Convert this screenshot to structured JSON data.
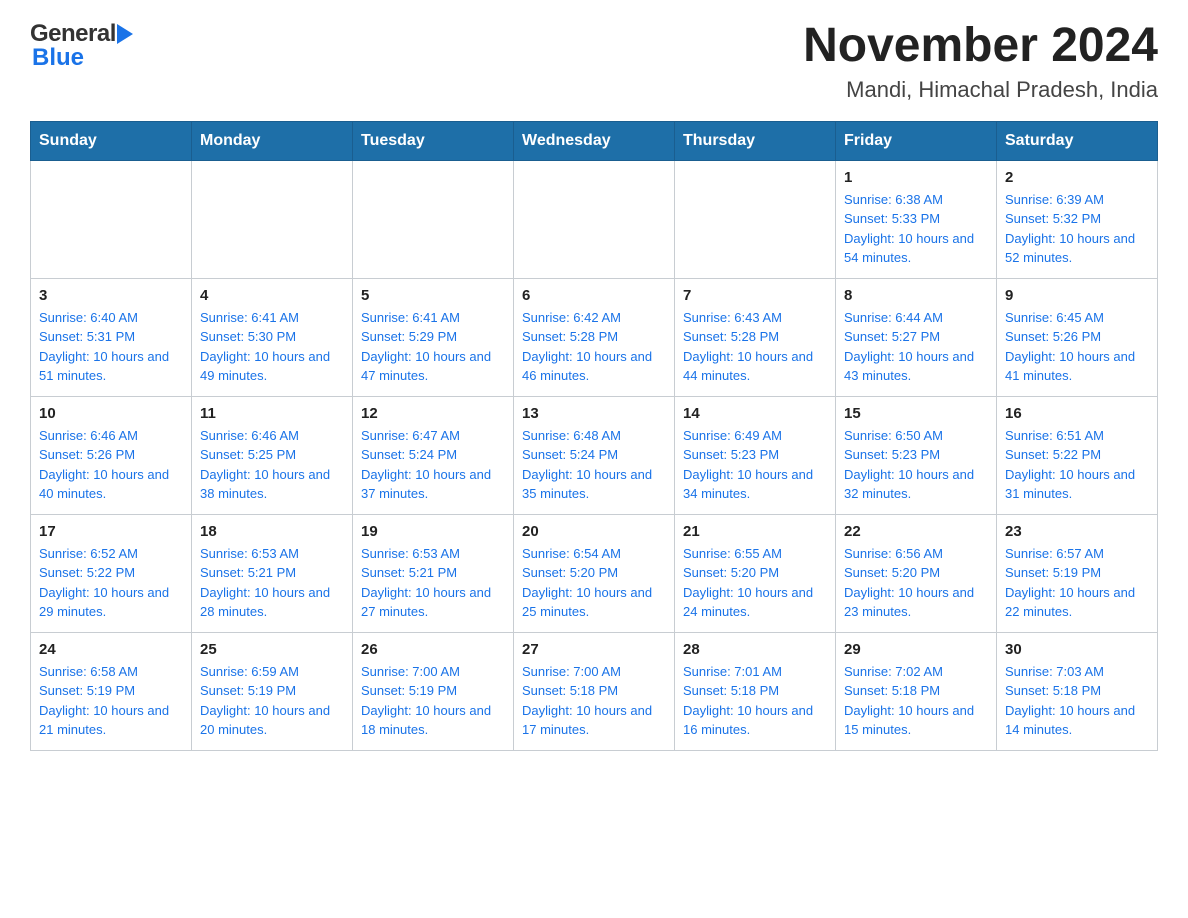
{
  "header": {
    "title": "November 2024",
    "subtitle": "Mandi, Himachal Pradesh, India",
    "logo_general": "General",
    "logo_blue": "Blue"
  },
  "days_of_week": [
    "Sunday",
    "Monday",
    "Tuesday",
    "Wednesday",
    "Thursday",
    "Friday",
    "Saturday"
  ],
  "weeks": [
    [
      {
        "day": "",
        "sunrise": "",
        "sunset": "",
        "daylight": ""
      },
      {
        "day": "",
        "sunrise": "",
        "sunset": "",
        "daylight": ""
      },
      {
        "day": "",
        "sunrise": "",
        "sunset": "",
        "daylight": ""
      },
      {
        "day": "",
        "sunrise": "",
        "sunset": "",
        "daylight": ""
      },
      {
        "day": "",
        "sunrise": "",
        "sunset": "",
        "daylight": ""
      },
      {
        "day": "1",
        "sunrise": "Sunrise: 6:38 AM",
        "sunset": "Sunset: 5:33 PM",
        "daylight": "Daylight: 10 hours and 54 minutes."
      },
      {
        "day": "2",
        "sunrise": "Sunrise: 6:39 AM",
        "sunset": "Sunset: 5:32 PM",
        "daylight": "Daylight: 10 hours and 52 minutes."
      }
    ],
    [
      {
        "day": "3",
        "sunrise": "Sunrise: 6:40 AM",
        "sunset": "Sunset: 5:31 PM",
        "daylight": "Daylight: 10 hours and 51 minutes."
      },
      {
        "day": "4",
        "sunrise": "Sunrise: 6:41 AM",
        "sunset": "Sunset: 5:30 PM",
        "daylight": "Daylight: 10 hours and 49 minutes."
      },
      {
        "day": "5",
        "sunrise": "Sunrise: 6:41 AM",
        "sunset": "Sunset: 5:29 PM",
        "daylight": "Daylight: 10 hours and 47 minutes."
      },
      {
        "day": "6",
        "sunrise": "Sunrise: 6:42 AM",
        "sunset": "Sunset: 5:28 PM",
        "daylight": "Daylight: 10 hours and 46 minutes."
      },
      {
        "day": "7",
        "sunrise": "Sunrise: 6:43 AM",
        "sunset": "Sunset: 5:28 PM",
        "daylight": "Daylight: 10 hours and 44 minutes."
      },
      {
        "day": "8",
        "sunrise": "Sunrise: 6:44 AM",
        "sunset": "Sunset: 5:27 PM",
        "daylight": "Daylight: 10 hours and 43 minutes."
      },
      {
        "day": "9",
        "sunrise": "Sunrise: 6:45 AM",
        "sunset": "Sunset: 5:26 PM",
        "daylight": "Daylight: 10 hours and 41 minutes."
      }
    ],
    [
      {
        "day": "10",
        "sunrise": "Sunrise: 6:46 AM",
        "sunset": "Sunset: 5:26 PM",
        "daylight": "Daylight: 10 hours and 40 minutes."
      },
      {
        "day": "11",
        "sunrise": "Sunrise: 6:46 AM",
        "sunset": "Sunset: 5:25 PM",
        "daylight": "Daylight: 10 hours and 38 minutes."
      },
      {
        "day": "12",
        "sunrise": "Sunrise: 6:47 AM",
        "sunset": "Sunset: 5:24 PM",
        "daylight": "Daylight: 10 hours and 37 minutes."
      },
      {
        "day": "13",
        "sunrise": "Sunrise: 6:48 AM",
        "sunset": "Sunset: 5:24 PM",
        "daylight": "Daylight: 10 hours and 35 minutes."
      },
      {
        "day": "14",
        "sunrise": "Sunrise: 6:49 AM",
        "sunset": "Sunset: 5:23 PM",
        "daylight": "Daylight: 10 hours and 34 minutes."
      },
      {
        "day": "15",
        "sunrise": "Sunrise: 6:50 AM",
        "sunset": "Sunset: 5:23 PM",
        "daylight": "Daylight: 10 hours and 32 minutes."
      },
      {
        "day": "16",
        "sunrise": "Sunrise: 6:51 AM",
        "sunset": "Sunset: 5:22 PM",
        "daylight": "Daylight: 10 hours and 31 minutes."
      }
    ],
    [
      {
        "day": "17",
        "sunrise": "Sunrise: 6:52 AM",
        "sunset": "Sunset: 5:22 PM",
        "daylight": "Daylight: 10 hours and 29 minutes."
      },
      {
        "day": "18",
        "sunrise": "Sunrise: 6:53 AM",
        "sunset": "Sunset: 5:21 PM",
        "daylight": "Daylight: 10 hours and 28 minutes."
      },
      {
        "day": "19",
        "sunrise": "Sunrise: 6:53 AM",
        "sunset": "Sunset: 5:21 PM",
        "daylight": "Daylight: 10 hours and 27 minutes."
      },
      {
        "day": "20",
        "sunrise": "Sunrise: 6:54 AM",
        "sunset": "Sunset: 5:20 PM",
        "daylight": "Daylight: 10 hours and 25 minutes."
      },
      {
        "day": "21",
        "sunrise": "Sunrise: 6:55 AM",
        "sunset": "Sunset: 5:20 PM",
        "daylight": "Daylight: 10 hours and 24 minutes."
      },
      {
        "day": "22",
        "sunrise": "Sunrise: 6:56 AM",
        "sunset": "Sunset: 5:20 PM",
        "daylight": "Daylight: 10 hours and 23 minutes."
      },
      {
        "day": "23",
        "sunrise": "Sunrise: 6:57 AM",
        "sunset": "Sunset: 5:19 PM",
        "daylight": "Daylight: 10 hours and 22 minutes."
      }
    ],
    [
      {
        "day": "24",
        "sunrise": "Sunrise: 6:58 AM",
        "sunset": "Sunset: 5:19 PM",
        "daylight": "Daylight: 10 hours and 21 minutes."
      },
      {
        "day": "25",
        "sunrise": "Sunrise: 6:59 AM",
        "sunset": "Sunset: 5:19 PM",
        "daylight": "Daylight: 10 hours and 20 minutes."
      },
      {
        "day": "26",
        "sunrise": "Sunrise: 7:00 AM",
        "sunset": "Sunset: 5:19 PM",
        "daylight": "Daylight: 10 hours and 18 minutes."
      },
      {
        "day": "27",
        "sunrise": "Sunrise: 7:00 AM",
        "sunset": "Sunset: 5:18 PM",
        "daylight": "Daylight: 10 hours and 17 minutes."
      },
      {
        "day": "28",
        "sunrise": "Sunrise: 7:01 AM",
        "sunset": "Sunset: 5:18 PM",
        "daylight": "Daylight: 10 hours and 16 minutes."
      },
      {
        "day": "29",
        "sunrise": "Sunrise: 7:02 AM",
        "sunset": "Sunset: 5:18 PM",
        "daylight": "Daylight: 10 hours and 15 minutes."
      },
      {
        "day": "30",
        "sunrise": "Sunrise: 7:03 AM",
        "sunset": "Sunset: 5:18 PM",
        "daylight": "Daylight: 10 hours and 14 minutes."
      }
    ]
  ]
}
